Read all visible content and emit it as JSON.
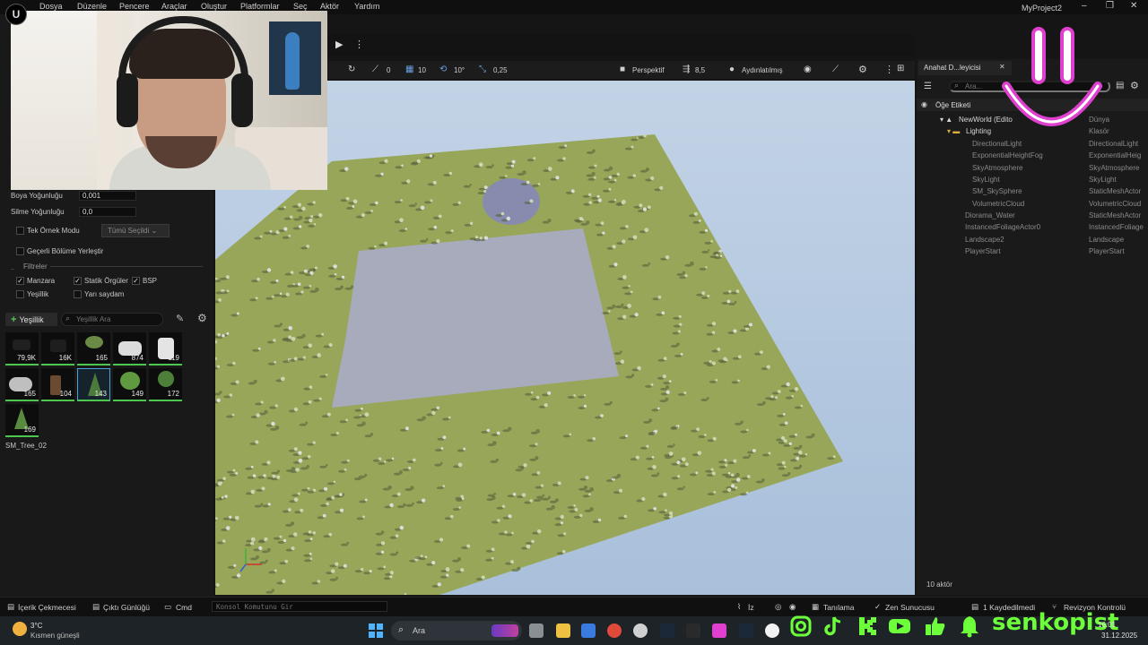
{
  "menu": {
    "items": [
      "Dosya",
      "Düzenle",
      "Pencere",
      "Araçlar",
      "Oluştur",
      "Platformlar",
      "Seç",
      "Aktör",
      "Yardım"
    ],
    "project_title": "MyProject2",
    "win_controls": [
      "–",
      "❐",
      "✕"
    ]
  },
  "left_panel": {
    "paint_density_label": "Boya Yoğunluğu",
    "paint_density_value": "0,001",
    "erase_density_label": "Silme Yoğunluğu",
    "erase_density_value": "0,0",
    "single_instance_label": "Tek Örnek Modu",
    "single_instance_dropdown": "Tümü Seçildi",
    "place_in_level_label": "Geçerli Bölüme Yerleştir",
    "filters_label": "Filtreler",
    "filters": [
      {
        "label": "Manzara",
        "checked": true
      },
      {
        "label": "Statik Örgüler",
        "checked": true
      },
      {
        "label": "BSP",
        "checked": true
      },
      {
        "label": "Yeşillik",
        "checked": false
      },
      {
        "label": "Yarı saydam",
        "checked": false
      }
    ],
    "foliage_button": "Yeşillik",
    "foliage_search_placeholder": "Yeşillik Ara",
    "tiles": [
      "79,9K",
      "16K",
      "165",
      "874",
      "119",
      "165",
      "104",
      "143",
      "149",
      "172",
      "169"
    ],
    "selected_tile_name": "SM_Tree_02"
  },
  "viewport_toolbar": {
    "rot_snap": "0",
    "grid_snap": "10",
    "angle_snap": "10°",
    "scale_snap": "0,25",
    "view_mode": "Perspektif",
    "camera_speed": "8,5",
    "lighting_mode": "Aydınlatılmış"
  },
  "outliner": {
    "tab_label": "Anahat D...leyicisi",
    "search_placeholder": "Ara...",
    "header_label": "Öğe Etiketi",
    "rows": [
      {
        "name": "NewWorld (Edito",
        "type": "Dünya"
      },
      {
        "name": "Lighting",
        "type": "Klasör"
      },
      {
        "name": "DirectionalLight",
        "type": "DirectionalLight"
      },
      {
        "name": "ExponentialHeightFog",
        "type": "ExponentialHeig"
      },
      {
        "name": "SkyAtmosphere",
        "type": "SkyAtmosphere"
      },
      {
        "name": "SkyLight",
        "type": "SkyLight"
      },
      {
        "name": "SM_SkySphere",
        "type": "StaticMeshActor"
      },
      {
        "name": "VolumetricCloud",
        "type": "VolumetricCloud"
      },
      {
        "name": "Diorama_Water",
        "type": "StaticMeshActor"
      },
      {
        "name": "InstancedFoliageActor0",
        "type": "InstancedFoliage"
      },
      {
        "name": "Landscape2",
        "type": "Landscape"
      },
      {
        "name": "PlayerStart",
        "type": "PlayerStart"
      }
    ],
    "actor_count": "10 aktör"
  },
  "statusbar": {
    "content_drawer": "İçerik Çekmecesi",
    "output_log": "Çıktı Günlüğü",
    "cmd": "Cmd",
    "console_placeholder": "Konsol Komutunu Gir",
    "trace": "İz",
    "derived": "Tanılama",
    "zen": "Zen Sunucusu",
    "saved": "1 Kaydedilmedi",
    "revision": "Revizyon Kontrolü"
  },
  "taskbar": {
    "weather_temp": "3°C",
    "weather_desc": "Kısmen güneşli",
    "search_placeholder": "Ara",
    "time": "16:01",
    "date": "31.12.2025"
  },
  "overlay": {
    "channel_name": "senkopist",
    "accent_color": "#6cff3a",
    "smile_color": "#e040d0"
  }
}
